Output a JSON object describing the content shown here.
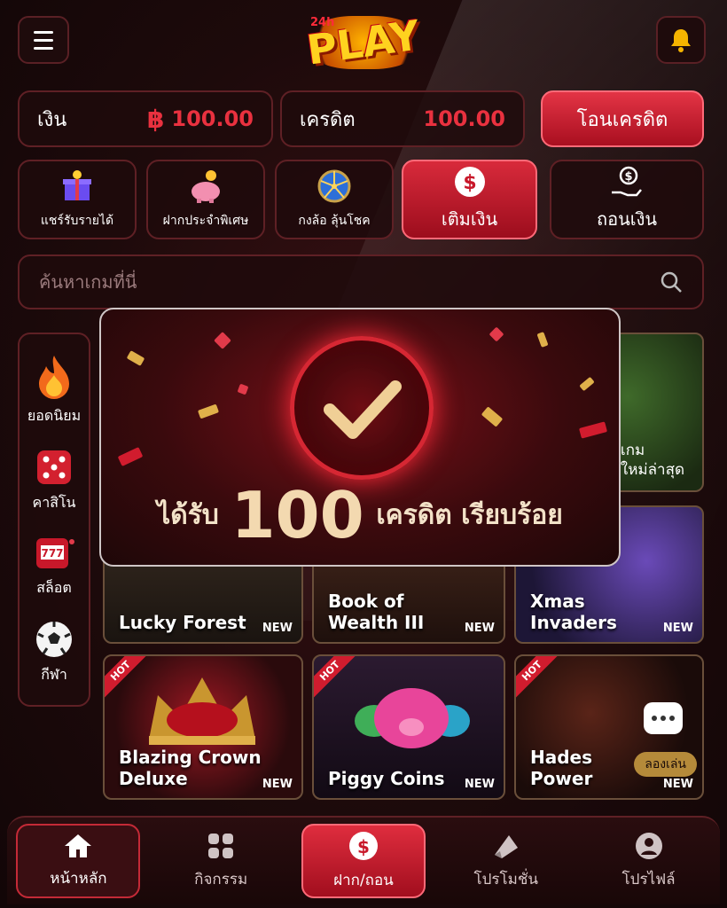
{
  "header": {
    "logo_prefix": "24h",
    "logo_text": "PLAY"
  },
  "balance": {
    "money_label": "เงิน",
    "money_currency": "฿",
    "money_value": "100.00",
    "credit_label": "เครดิต",
    "credit_value": "100.00",
    "transfer_button": "โอนเครดิต"
  },
  "actions": [
    {
      "label": "แชร์รับรายได้",
      "icon": "gift-icon"
    },
    {
      "label": "ฝากประจำพิเศษ",
      "icon": "piggy-bank-icon"
    },
    {
      "label": "กงล้อ ลุ้นโชค",
      "icon": "wheel-icon"
    },
    {
      "label": "เติมเงิน",
      "icon": "dollar-icon"
    },
    {
      "label": "ถอนเงิน",
      "icon": "withdraw-icon"
    }
  ],
  "search": {
    "placeholder": "ค้นหาเกมที่นี่"
  },
  "categories": [
    {
      "label": "ยอดนิยม",
      "icon": "fire-icon"
    },
    {
      "label": "คาสิโน",
      "icon": "dice-icon"
    },
    {
      "label": "สล็อต",
      "icon": "slot-machine-icon"
    },
    {
      "label": "กีฬา",
      "icon": "soccer-ball-icon"
    }
  ],
  "partial_card": {
    "line1": "เกม",
    "line2": "ใหม่ล่าสุด"
  },
  "games": [
    {
      "name": "Lucky Forest",
      "badge": "NEW",
      "hot": ""
    },
    {
      "name": "Book of Wealth III",
      "badge": "NEW",
      "hot": ""
    },
    {
      "name": "Xmas Invaders",
      "badge": "NEW",
      "hot": ""
    },
    {
      "name": "Blazing Crown Deluxe",
      "badge": "NEW",
      "hot": "HOT"
    },
    {
      "name": "Piggy Coins",
      "badge": "NEW",
      "hot": "HOT"
    },
    {
      "name": "Hades Power",
      "badge": "NEW",
      "hot": "HOT",
      "try": "ลองเล่น"
    }
  ],
  "modal": {
    "prefix": "ได้รับ",
    "amount": "100",
    "suffix": "เครดิต เรียบร้อย"
  },
  "bottom_nav": [
    {
      "label": "หน้าหลัก",
      "icon": "home-icon"
    },
    {
      "label": "กิจกรรม",
      "icon": "grid-icon"
    },
    {
      "label": "ฝาก/ถอน",
      "icon": "dollar-icon"
    },
    {
      "label": "โปรโมชั่น",
      "icon": "promo-icon"
    },
    {
      "label": "โปรไฟล์",
      "icon": "profile-icon"
    }
  ],
  "colors": {
    "accent": "#e9313f",
    "gold": "#f3d9b0",
    "bg": "#150708"
  }
}
